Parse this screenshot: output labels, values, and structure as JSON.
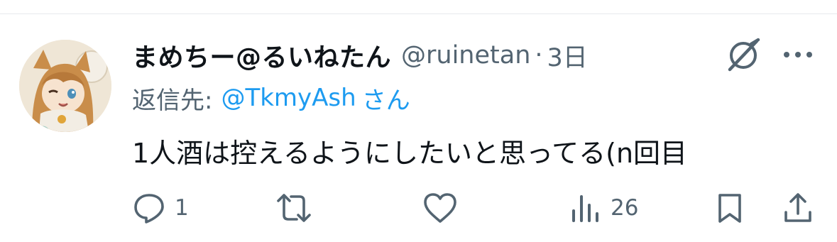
{
  "tweet": {
    "author": {
      "display_name": "まめちー@るいねたん",
      "handle": "@ruinetan",
      "avatar": "anime-girl-avatar"
    },
    "separator": "·",
    "timestamp": "3日",
    "reply_prefix": "返信先:",
    "reply_to": "@TkmyAsh",
    "reply_suffix": "さん",
    "text": "1人酒は控えるようにしたいと思ってる(n回目",
    "actions": {
      "reply": {
        "icon": "reply-icon",
        "count": "1"
      },
      "retweet": {
        "icon": "retweet-icon",
        "count": ""
      },
      "like": {
        "icon": "heart-icon",
        "count": ""
      },
      "views": {
        "icon": "views-icon",
        "count": "26"
      },
      "bookmark": {
        "icon": "bookmark-icon"
      },
      "share": {
        "icon": "share-icon"
      }
    },
    "header_icons": {
      "grok": "grok-icon",
      "more": "more-icon"
    }
  },
  "colors": {
    "text": "#0f1419",
    "secondary": "#536471",
    "link": "#1d9bf0",
    "divider": "#e8eaed"
  }
}
